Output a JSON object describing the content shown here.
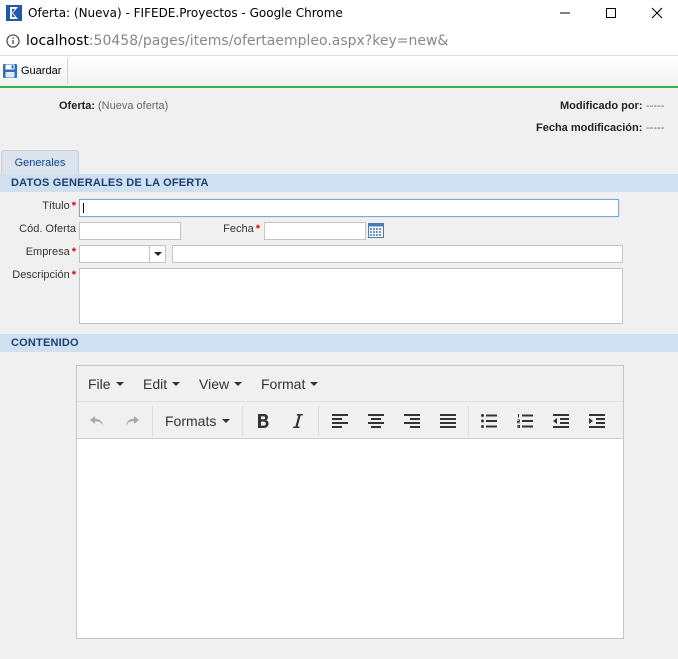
{
  "window": {
    "title": "Oferta: (Nueva) - FIFEDE.Proyectos - Google Chrome",
    "url_host": "localhost",
    "url_rest": ":50458/pages/items/ofertaempleo.aspx?key=new&"
  },
  "toolbar": {
    "save_label": "Guardar"
  },
  "header": {
    "oferta_label": "Oferta:",
    "oferta_value": "(Nueva oferta)",
    "modificado_label": "Modificado por:",
    "modificado_value": "-----",
    "fecha_mod_label": "Fecha modificación:",
    "fecha_mod_value": "-----"
  },
  "tabs": [
    {
      "label": "Generales"
    }
  ],
  "sections": {
    "datos": "DATOS GENERALES DE LA OFERTA",
    "contenido": "CONTENIDO"
  },
  "form": {
    "titulo_label": "Título",
    "titulo_value": "",
    "cod_label": "Cód. Oferta",
    "cod_value": "",
    "fecha_label": "Fecha",
    "fecha_value": "",
    "empresa_label": "Empresa",
    "empresa_value": "",
    "empresa_name_value": "",
    "descripcion_label": "Descripción",
    "descripcion_value": "",
    "required_mark": "*"
  },
  "editor": {
    "menus": [
      "File",
      "Edit",
      "View",
      "Format"
    ],
    "formats_label": "Formats",
    "content": ""
  },
  "colors": {
    "accent_green": "#37b34a",
    "section_bg": "#cfe0f0",
    "section_text": "#1a3f73",
    "required": "#d00000"
  }
}
